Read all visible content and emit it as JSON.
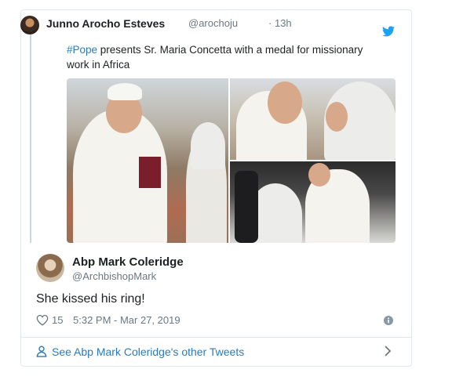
{
  "quoted_tweet": {
    "author_name": "Junno Arocho Esteves",
    "author_handle": "@arochoju",
    "separator": "·",
    "time_ago": "13h",
    "hashtag": "#Pope",
    "text": " presents Sr. Maria Concetta with a medal for missionary work in Africa",
    "icons": {
      "avatar": "avatar",
      "brand": "twitter-bird-icon"
    }
  },
  "reply": {
    "author_name": "Abp Mark Coleridge",
    "author_handle": "@ArchbishopMark",
    "text": "She kissed his ring!",
    "like_count": "15",
    "timestamp": "5:32 PM - Mar 27, 2019"
  },
  "footer": {
    "link_label": "See Abp Mark Coleridge's other Tweets"
  },
  "colors": {
    "link": "#2b7bb9",
    "muted": "#697882",
    "border": "#e1e8ed",
    "text": "#1c2022"
  }
}
